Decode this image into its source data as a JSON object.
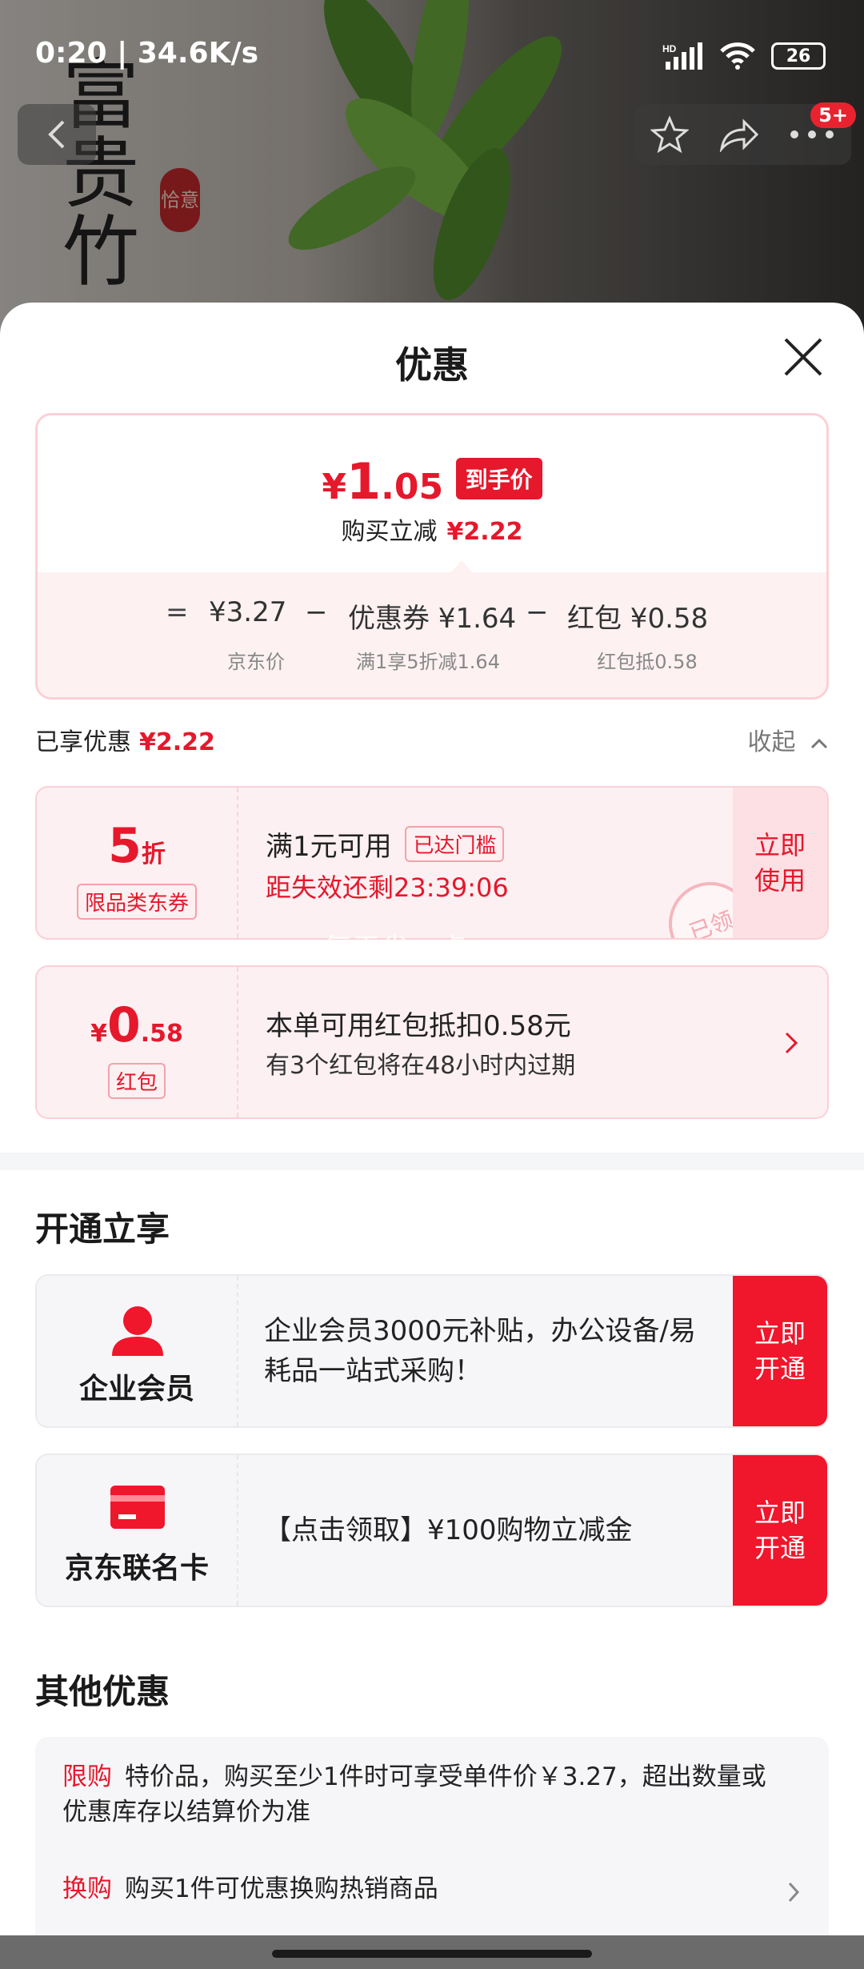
{
  "status_bar": {
    "time": "0:20 | 34.6K/s",
    "battery": "26",
    "network": "HD"
  },
  "hero": {
    "vertical_text": "富贵竹",
    "seal_text": "恰意",
    "notification_badge": "5+"
  },
  "sheet": {
    "title": "优惠",
    "price": {
      "currency": "¥",
      "integer": "1",
      "decimal": ".05",
      "tag": "到手价",
      "discount_label": "购买立减",
      "discount_value": "¥2.22"
    },
    "breakdown": {
      "equals": "=",
      "items": [
        {
          "value": "¥3.27",
          "sub": "京东价"
        },
        {
          "op": "−",
          "value": "优惠券 ¥1.64",
          "sub": "满1享5折减1.64"
        },
        {
          "op": "−",
          "value": "红包 ¥0.58",
          "sub": "红包抵0.58"
        }
      ]
    },
    "enjoyed": {
      "label": "已享优惠",
      "value": "¥2.22",
      "collapse_label": "收起"
    },
    "coupon": {
      "amount": "5",
      "unit": "折",
      "type_tag": "限品类东券",
      "title": "满1元可用",
      "threshold_tag": "已达门槛",
      "countdown": "距失效还剩23:39:06",
      "action": [
        "立即",
        "使用"
      ],
      "stamp": "已领"
    },
    "watermark": "每天省一点",
    "redpacket": {
      "currency": "¥",
      "amount_int": "0",
      "amount_dec": ".58",
      "type_tag": "红包",
      "title": "本单可用红包抵扣0.58元",
      "subtitle": "有3个红包将在48小时内过期"
    },
    "open_section": {
      "title": "开通立享",
      "items": [
        {
          "label": "企业会员",
          "text": " 企业会员3000元补贴，办公设备/易耗品一站式采购！",
          "action": [
            "立即",
            "开通"
          ]
        },
        {
          "label": "京东联名卡",
          "text": "【点击领取】¥100购物立减金",
          "action": [
            "立即",
            "开通"
          ]
        }
      ]
    },
    "other_section": {
      "title": "其他优惠",
      "rows": [
        {
          "key": "限购",
          "text": "特价品，购买至少1件时可享受单件价￥3.27，超出数量或优惠库存以结算价为准"
        },
        {
          "key": "换购",
          "text": "购买1件可优惠换购热销商品"
        }
      ]
    }
  },
  "colors": {
    "accent": "#e5182c",
    "accent_light": "#fdf0f2",
    "action_red": "#f0162b"
  }
}
